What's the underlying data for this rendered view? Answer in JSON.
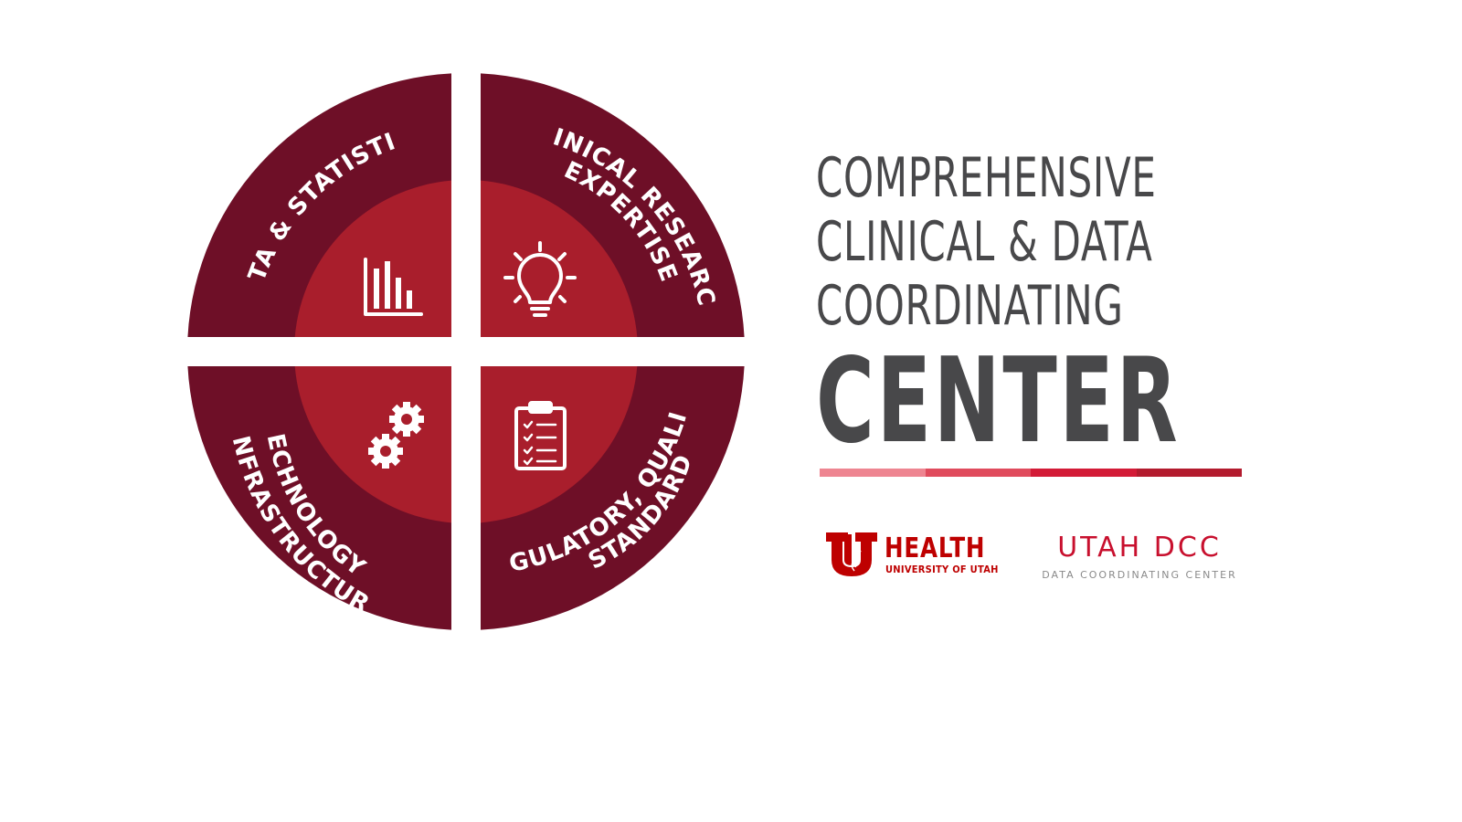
{
  "diagram": {
    "quadrants": [
      {
        "id": "data-statistics",
        "lines": [
          "DATA & STATISTICS"
        ],
        "icon": "bar-chart-icon"
      },
      {
        "id": "clinical-research",
        "lines": [
          "CLINICAL RESEARCH",
          "EXPERTISE"
        ],
        "icon": "lightbulb-icon"
      },
      {
        "id": "technology",
        "lines": [
          "TECHNOLOGY &",
          "INFRASTRUCTURE"
        ],
        "icon": "gears-icon"
      },
      {
        "id": "regulatory",
        "lines": [
          "REGULATORY, QUALITY,",
          "& STANDARDS"
        ],
        "icon": "clipboard-checklist-icon"
      }
    ]
  },
  "title": {
    "line1": "COMPREHENSIVE",
    "line2": "CLINICAL & DATA",
    "line3": "COORDINATING",
    "line4": "CENTER"
  },
  "logos": {
    "health": {
      "word": "HEALTH",
      "sub": "UNIVERSITY OF UTAH"
    },
    "dcc": {
      "word": "UTAH DCC",
      "sub": "DATA COORDINATING CENTER"
    }
  },
  "colors": {
    "outer_ring": "#6e0f27",
    "inner_core": "#a91e2c",
    "title_text": "#48484a",
    "brand_red": "#be0000",
    "dcc_red": "#c8102e",
    "dcc_gray": "#8a8a8a",
    "accent_bar": [
      "#ee8591",
      "#e04b5d",
      "#d31b37",
      "#b31b2e"
    ]
  }
}
